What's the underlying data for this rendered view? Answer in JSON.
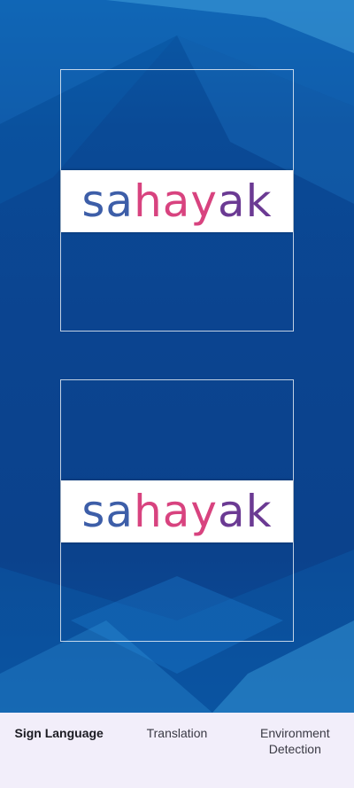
{
  "app": {
    "logo": {
      "parts": [
        {
          "text": "sa",
          "color": "#3d5ea8"
        },
        {
          "text": "hay",
          "color": "#d8437f"
        },
        {
          "text": "ak",
          "color": "#6b3a93"
        }
      ]
    }
  },
  "colors": {
    "background": "#0b4490",
    "nav_background": "#f2eefa",
    "frame_border": "#ffffff"
  },
  "bottom_nav": {
    "items": [
      {
        "label": "Sign Language",
        "active": true
      },
      {
        "label": "Translation",
        "active": false
      },
      {
        "label": "Environment Detection",
        "active": false
      }
    ]
  }
}
